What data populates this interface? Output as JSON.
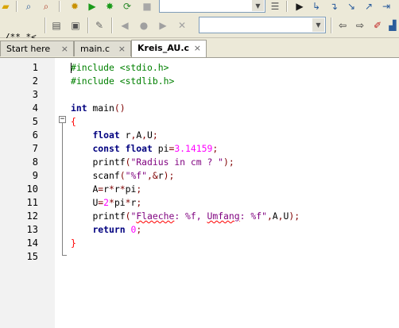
{
  "tabs": [
    {
      "label": "Start here",
      "close": "×"
    },
    {
      "label": "main.c",
      "close": "×"
    },
    {
      "label": "Kreis_AU.c",
      "close": "×"
    }
  ],
  "toolbar": {
    "comment_label": "/** *<"
  },
  "editor": {
    "line_numbers": [
      "1",
      "2",
      "3",
      "4",
      "5",
      "6",
      "7",
      "8",
      "9",
      "10",
      "11",
      "12",
      "13",
      "14",
      "15"
    ],
    "fold_marker": "−"
  },
  "colors": {
    "preprocessor": "#008000",
    "keyword": "#00007f",
    "number": "#ff00ff",
    "string": "#7f007f",
    "brace": "#ff0000"
  }
}
